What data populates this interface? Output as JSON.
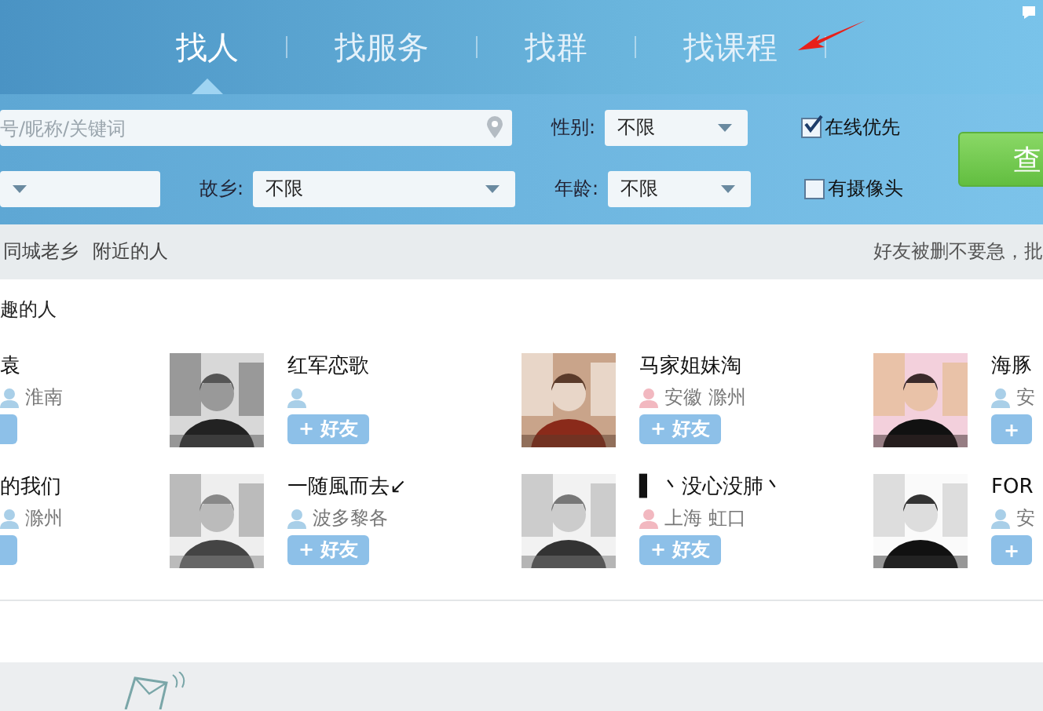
{
  "tabs": [
    {
      "label": "找人",
      "selected": true
    },
    {
      "label": "找服务",
      "selected": false
    },
    {
      "label": "找群",
      "selected": false
    },
    {
      "label": "找课程",
      "selected": false
    }
  ],
  "search": {
    "placeholder": "号/昵称/关键词",
    "gender_label": "性别:",
    "gender": "不限",
    "hometown_label": "故乡:",
    "hometown": "不限",
    "age_label": "年龄:",
    "age": "不限",
    "online_first": {
      "label": "在线优先",
      "checked": true
    },
    "has_camera": {
      "label": "有摄像头",
      "checked": false
    },
    "submit": "查"
  },
  "links": [
    "同城老乡",
    "附近的人"
  ],
  "notice": "好友被删不要急，批",
  "section_title": "趣的人",
  "people": [
    {
      "kind": "cut",
      "name": "袁",
      "location": "淮南",
      "color": "#a9cfe8"
    },
    {
      "kind": "full",
      "name": "红军恋歌",
      "color": "#a9cfe8",
      "add": "+ 好友"
    },
    {
      "kind": "full",
      "name": "马家姐妹淘",
      "location": "安徽 滁州",
      "color": "#f2b8c0",
      "add": "+ 好友"
    },
    {
      "kind": "full",
      "name": "海豚",
      "location": "安",
      "color": "#a9cfe8",
      "add": "+"
    },
    {
      "kind": "cut",
      "name": "的我们",
      "location": "滁州",
      "color": "#a9cfe8"
    },
    {
      "kind": "full",
      "name": "一随風而去↙",
      "location": "波多黎各",
      "color": "#a9cfe8",
      "add": "+ 好友"
    },
    {
      "kind": "full",
      "name": "▌ 丶没心没肺丶",
      "location": "上海 虹口",
      "color": "#f2b8c0",
      "add": "+ 好友"
    },
    {
      "kind": "full",
      "name": "FOR",
      "location": "安",
      "color": "#a9cfe8",
      "add": "+"
    }
  ]
}
